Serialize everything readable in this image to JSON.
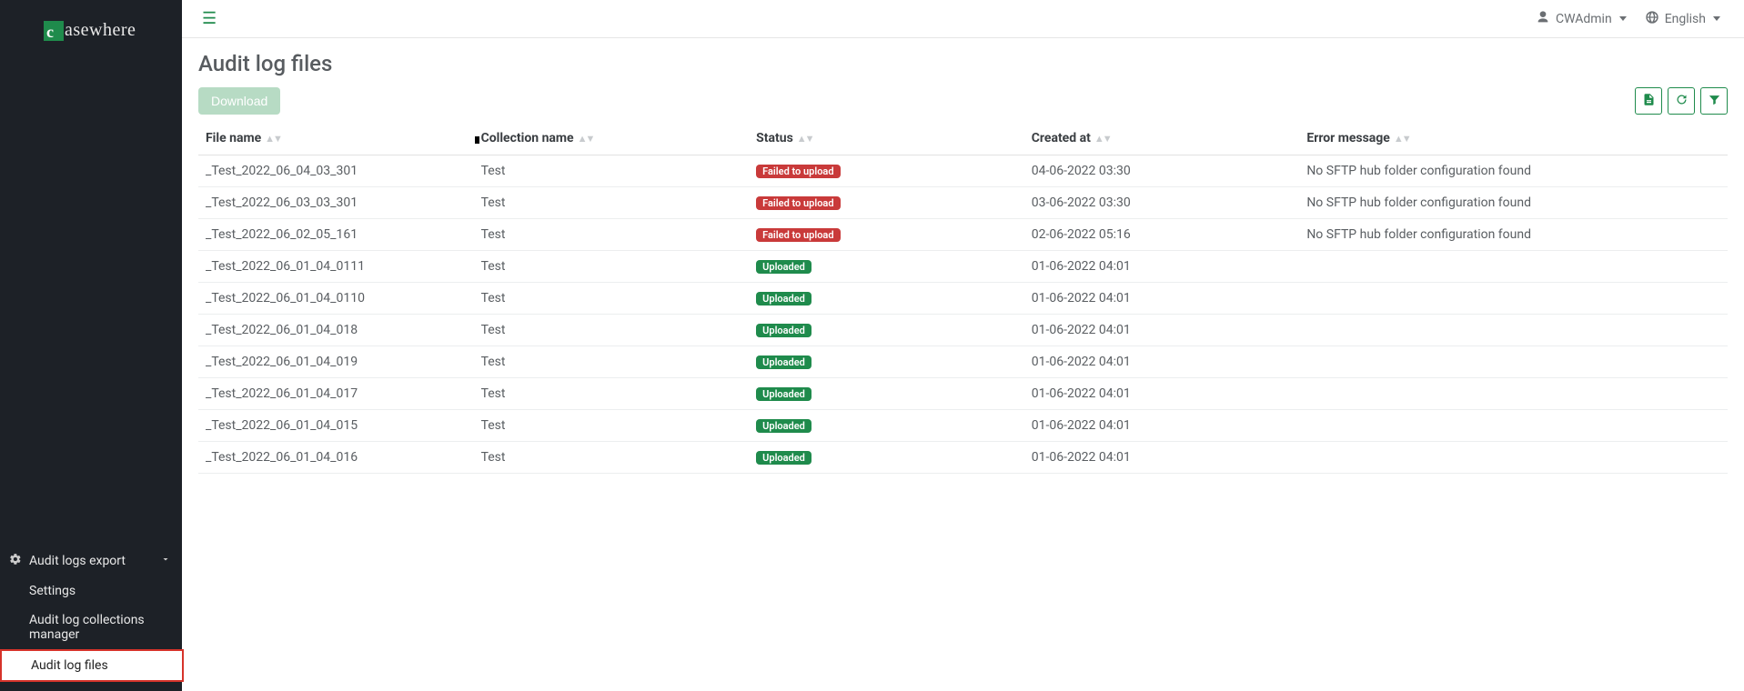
{
  "brand": {
    "mark_letter": "c",
    "word": "asewhere"
  },
  "sidebar": {
    "group_label": "Audit logs export",
    "items": [
      {
        "label": "Settings"
      },
      {
        "label": "Audit log collections manager"
      },
      {
        "label": "Audit log files",
        "active": true
      }
    ]
  },
  "topbar": {
    "user_label": "CWAdmin",
    "lang_label": "English"
  },
  "page": {
    "title": "Audit log files",
    "download_label": "Download"
  },
  "columns": {
    "file_name": "File name",
    "collection_name": "Collection name",
    "status": "Status",
    "created_at": "Created at",
    "error_message": "Error message"
  },
  "status_labels": {
    "failed": "Failed to upload",
    "uploaded": "Uploaded"
  },
  "rows": [
    {
      "file_name": "_Test_2022_06_04_03_301",
      "collection_name": "Test",
      "status": "failed",
      "created_at": "04-06-2022 03:30",
      "error_message": "No SFTP hub folder configuration found"
    },
    {
      "file_name": "_Test_2022_06_03_03_301",
      "collection_name": "Test",
      "status": "failed",
      "created_at": "03-06-2022 03:30",
      "error_message": "No SFTP hub folder configuration found"
    },
    {
      "file_name": "_Test_2022_06_02_05_161",
      "collection_name": "Test",
      "status": "failed",
      "created_at": "02-06-2022 05:16",
      "error_message": "No SFTP hub folder configuration found"
    },
    {
      "file_name": "_Test_2022_06_01_04_0111",
      "collection_name": "Test",
      "status": "uploaded",
      "created_at": "01-06-2022 04:01",
      "error_message": ""
    },
    {
      "file_name": "_Test_2022_06_01_04_0110",
      "collection_name": "Test",
      "status": "uploaded",
      "created_at": "01-06-2022 04:01",
      "error_message": ""
    },
    {
      "file_name": "_Test_2022_06_01_04_018",
      "collection_name": "Test",
      "status": "uploaded",
      "created_at": "01-06-2022 04:01",
      "error_message": ""
    },
    {
      "file_name": "_Test_2022_06_01_04_019",
      "collection_name": "Test",
      "status": "uploaded",
      "created_at": "01-06-2022 04:01",
      "error_message": ""
    },
    {
      "file_name": "_Test_2022_06_01_04_017",
      "collection_name": "Test",
      "status": "uploaded",
      "created_at": "01-06-2022 04:01",
      "error_message": ""
    },
    {
      "file_name": "_Test_2022_06_01_04_015",
      "collection_name": "Test",
      "status": "uploaded",
      "created_at": "01-06-2022 04:01",
      "error_message": ""
    },
    {
      "file_name": "_Test_2022_06_01_04_016",
      "collection_name": "Test",
      "status": "uploaded",
      "created_at": "01-06-2022 04:01",
      "error_message": ""
    }
  ]
}
